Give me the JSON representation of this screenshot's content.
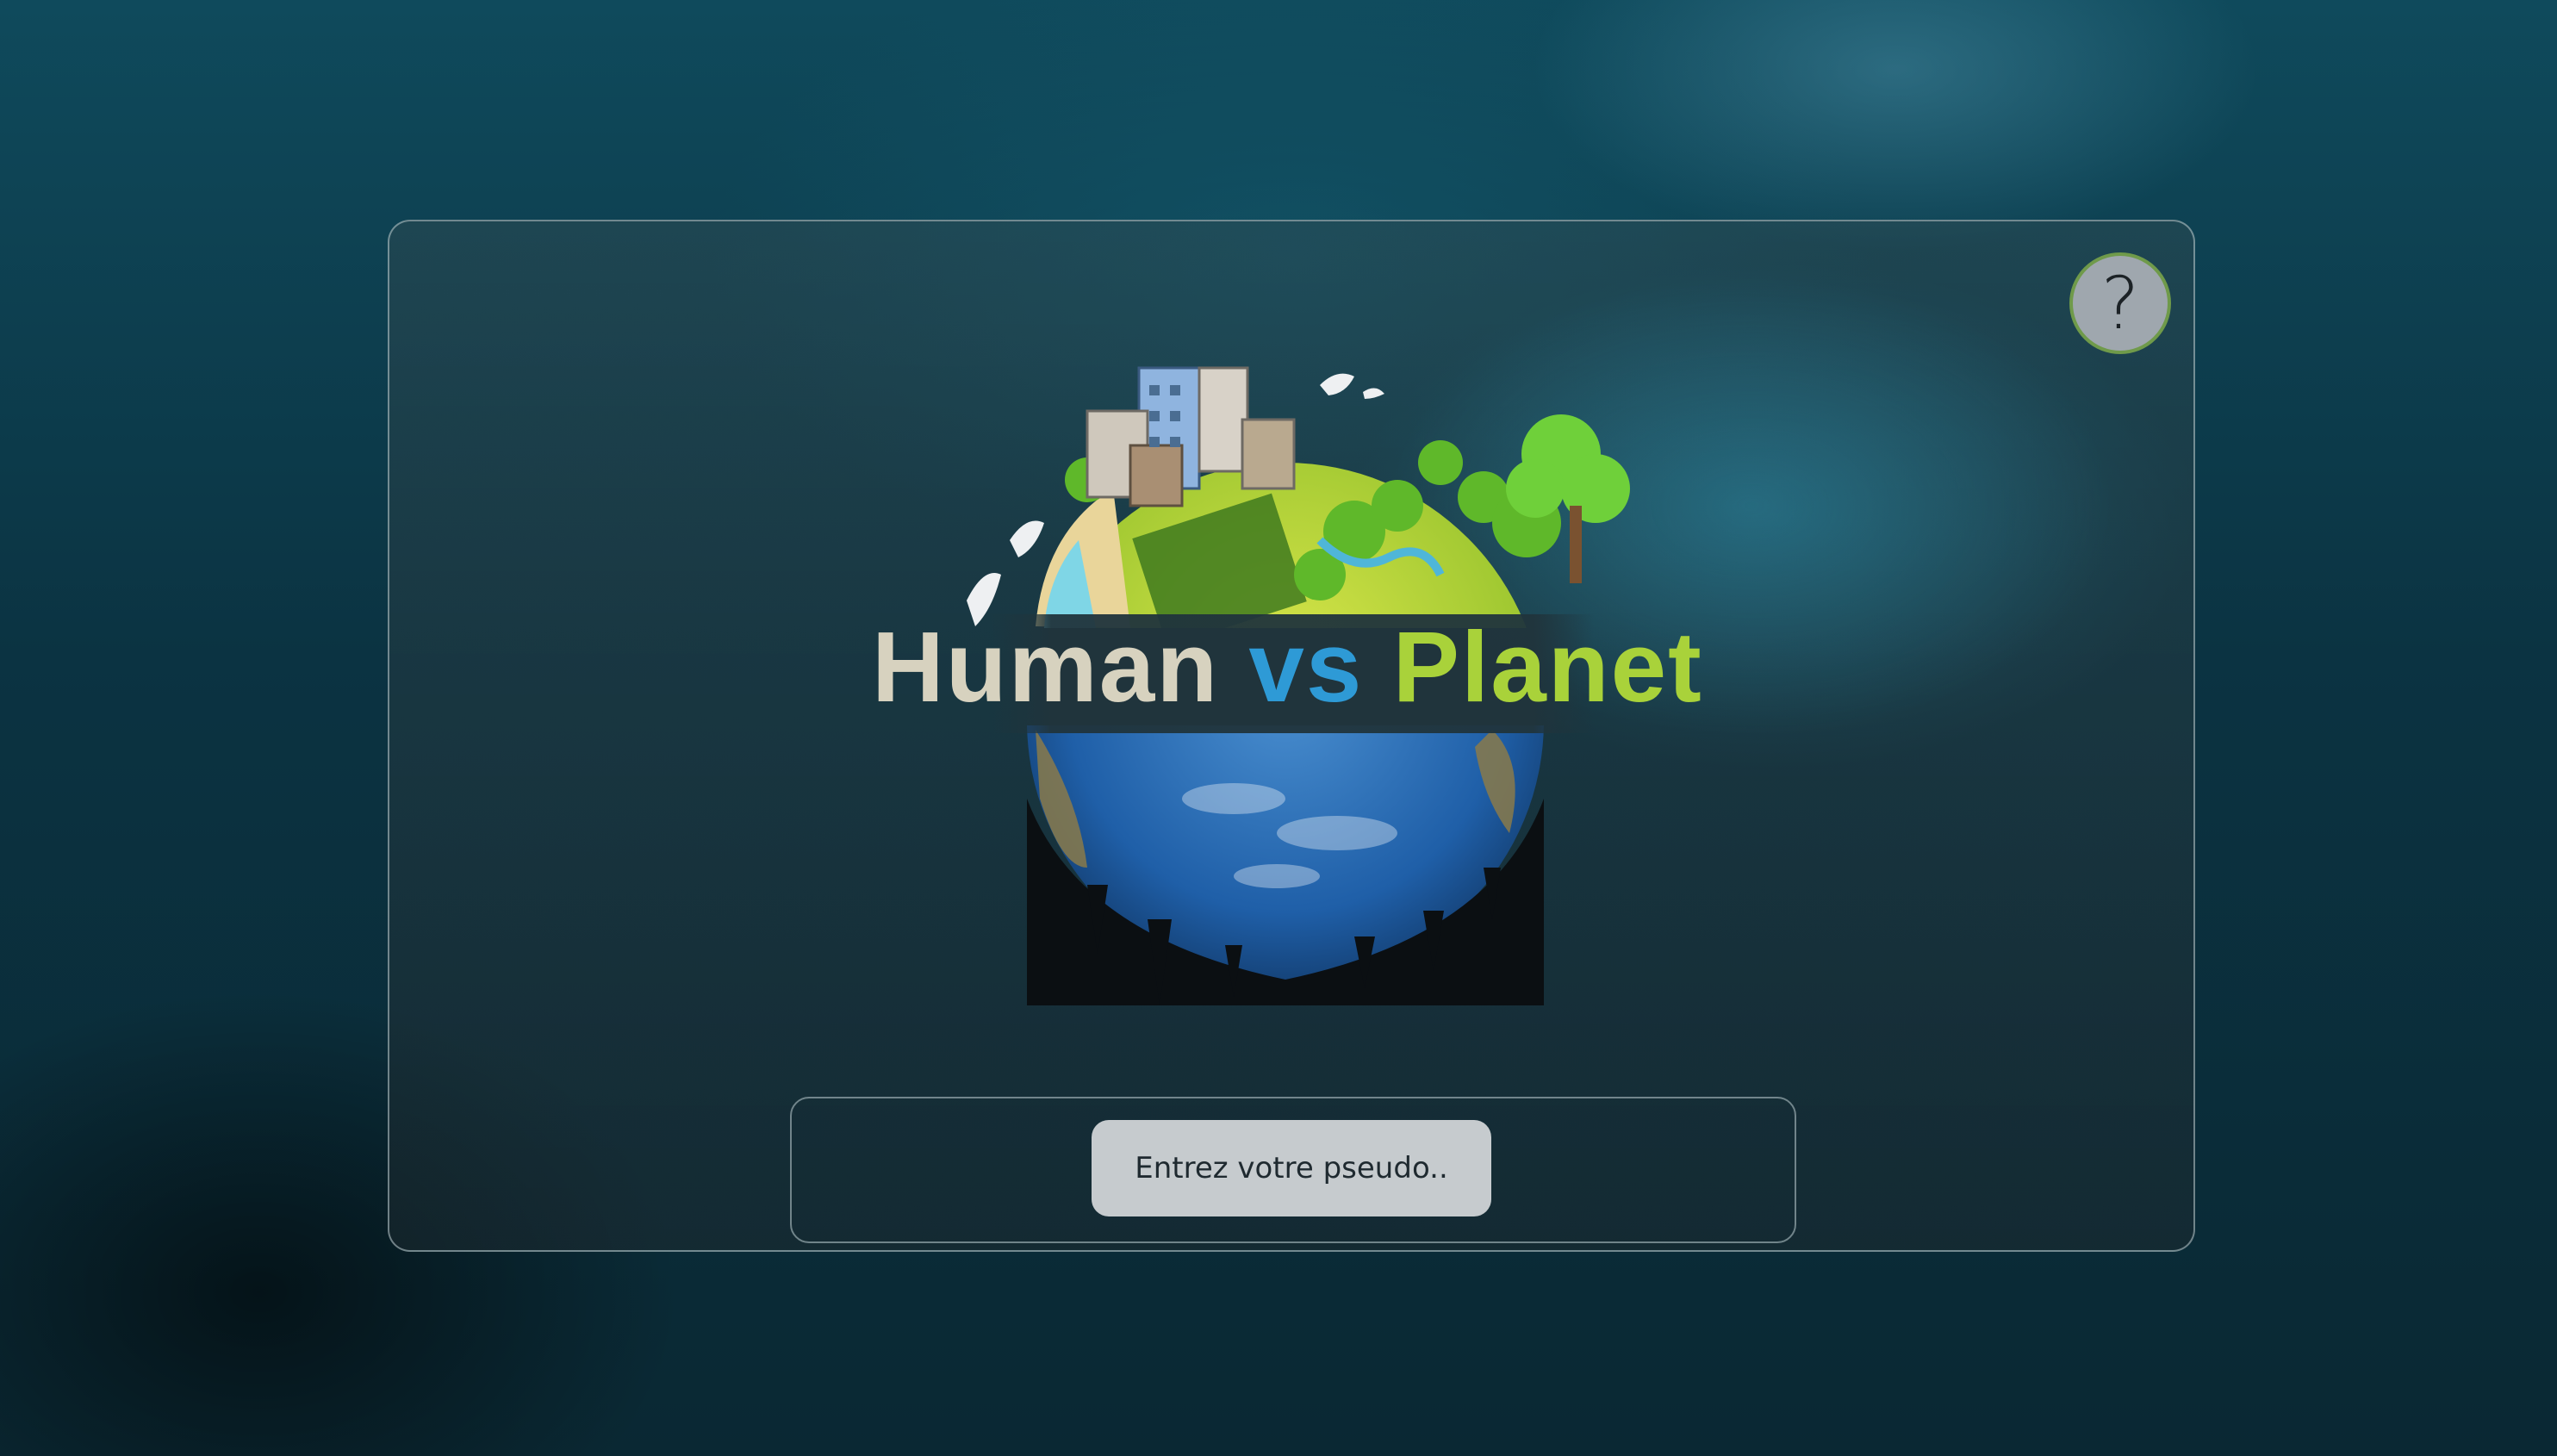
{
  "app": {
    "title_parts": [
      "Human",
      "vs",
      "Planet"
    ]
  },
  "help_button": {
    "label": "?"
  },
  "pseudo_input": {
    "placeholder": "Entrez votre pseudo..",
    "value": ""
  },
  "colors": {
    "human": "#d7d2bf",
    "vs": "#2e9ad6",
    "planet": "#a9d23a",
    "help_border": "#6f9a4a"
  },
  "icons": {
    "help": "question-mark-icon",
    "logo": "planet-globe-logo"
  }
}
